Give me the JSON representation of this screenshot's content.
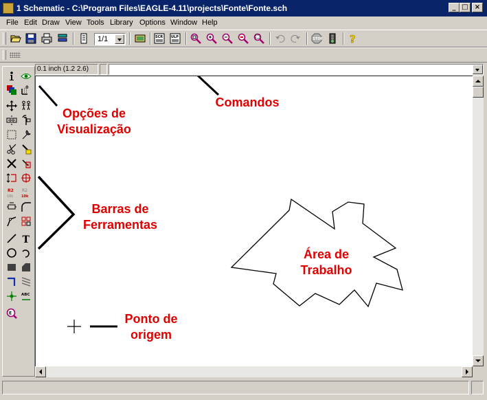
{
  "window": {
    "title": "1 Schematic - C:\\Program Files\\EAGLE-4.11\\projects\\Fonte\\Fonte.sch",
    "minimize_symbol": "_",
    "maximize_symbol": "□",
    "close_symbol": "×"
  },
  "menu": {
    "items": [
      "File",
      "Edit",
      "Draw",
      "View",
      "Tools",
      "Library",
      "Options",
      "Window",
      "Help"
    ]
  },
  "toolbar": {
    "sheet_value": "1/1",
    "icons": [
      "open-icon",
      "save-icon",
      "print-icon",
      "cam-icon",
      "sheet-icon",
      "board-icon",
      "script-icon",
      "ulp-icon",
      "zoom-fit-icon",
      "zoom-in-icon",
      "zoom-out-icon",
      "zoom-redraw-icon",
      "zoom-select-icon",
      "undo-icon",
      "redo-icon",
      "stop-icon",
      "go-icon",
      "help-icon"
    ]
  },
  "command": {
    "coordinate_text": "0.1 inch (1.2 2.6)",
    "value": ""
  },
  "annotations": {
    "comandos": "Comandos",
    "opcoes_line1": "Opções de",
    "opcoes_line2": "Visualização",
    "barras_line1": "Barras de",
    "barras_line2": "Ferramentas",
    "area_line1": "Área de",
    "area_line2": "Trabalho",
    "ponto_line1": "Ponto de",
    "ponto_line2": "origem",
    "color": "#e00000"
  }
}
